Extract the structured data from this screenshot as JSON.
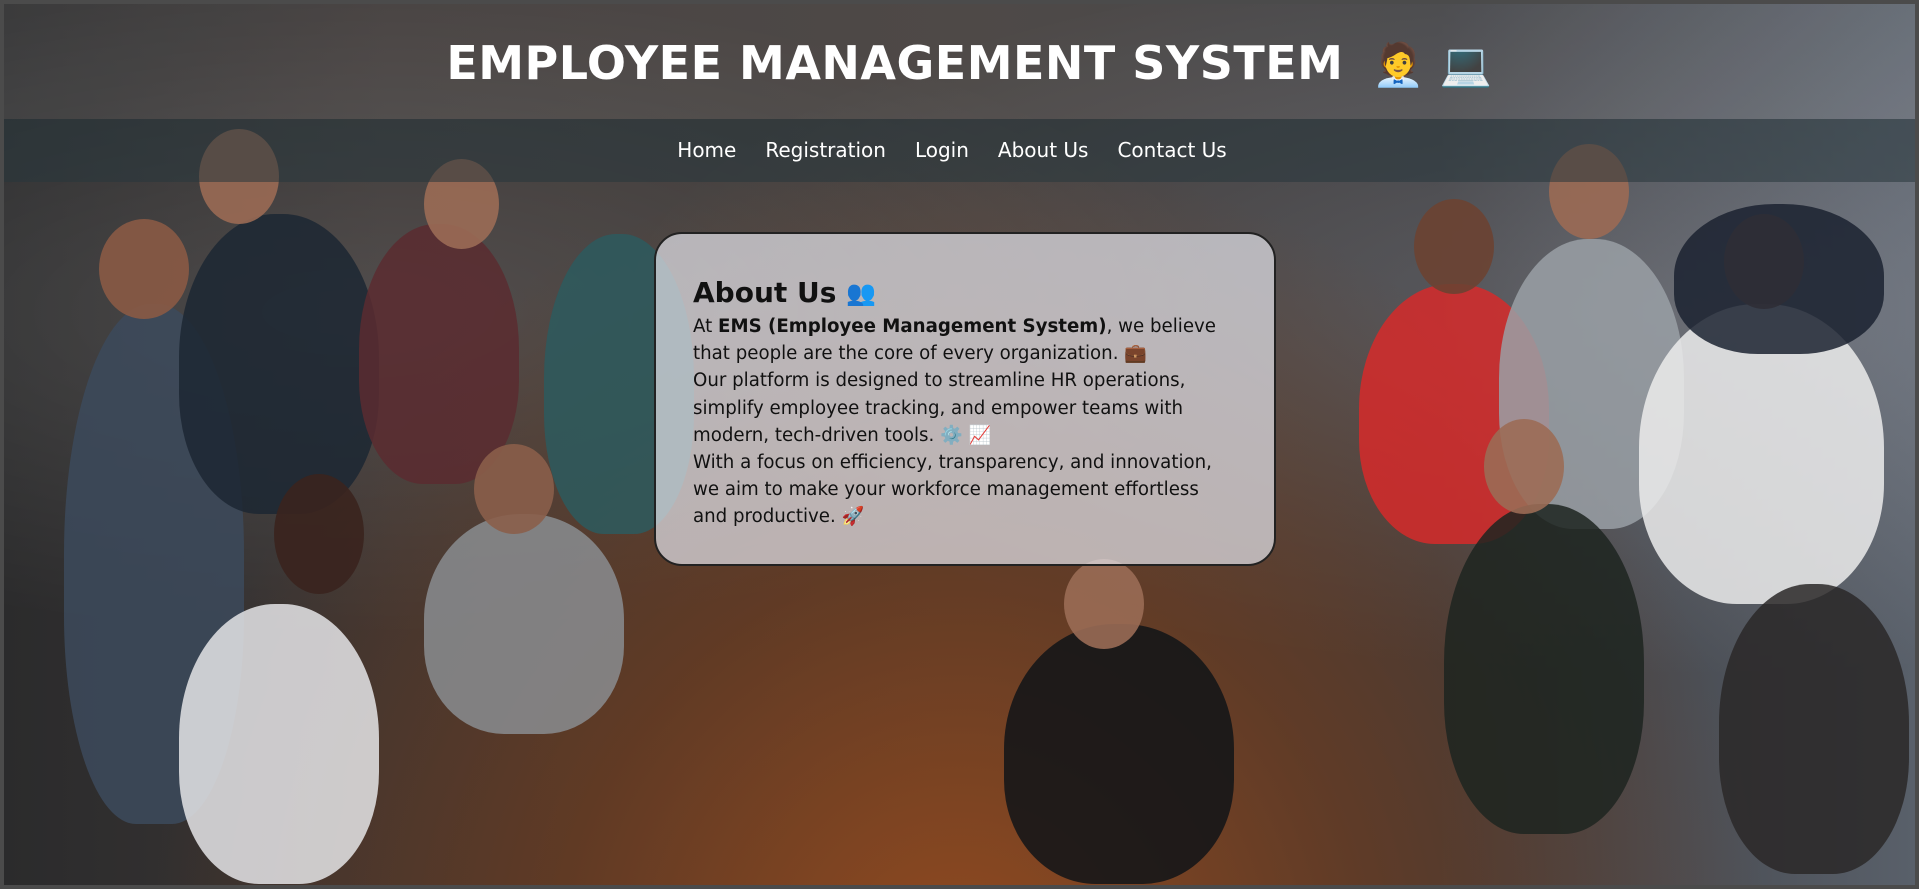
{
  "header": {
    "title": "EMPLOYEE MANAGEMENT SYSTEM",
    "title_emoji": "🧑‍💼 💻"
  },
  "nav": {
    "items": [
      "Home",
      "Registration",
      "Login",
      "About Us",
      "Contact Us"
    ]
  },
  "about": {
    "heading": "About Us",
    "heading_emoji": "👥",
    "line1_prefix": "At ",
    "line1_bold": "EMS (Employee Management System)",
    "line1_suffix": ", we believe that people are the core of every organization. 💼",
    "paragraph2": "Our platform is designed to streamline HR operations, simplify employee tracking, and empower teams with modern, tech-driven tools. ⚙️ 📈",
    "paragraph3": "With a focus on efficiency, transparency, and innovation, we aim to make your workforce management effortless and productive. 🚀"
  },
  "colors": {
    "title_text": "#ffffff",
    "nav_text": "#ffffff",
    "card_background": "#e1e1e8",
    "card_border": "#222222"
  }
}
